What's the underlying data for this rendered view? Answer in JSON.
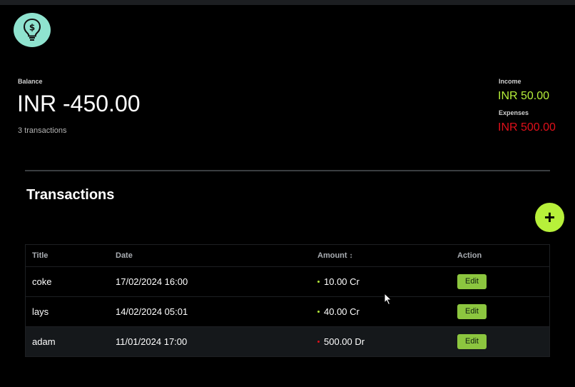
{
  "app": {
    "logo_icon": "lightbulb-dollar-icon"
  },
  "summary": {
    "balance_label": "Balance",
    "balance_value": "INR -450.00",
    "transaction_count": "3 transactions",
    "income_label": "Income",
    "income_value": "INR 50.00",
    "expenses_label": "Expenses",
    "expenses_value": "INR 500.00"
  },
  "transactions": {
    "title": "Transactions",
    "add_icon": "plus-icon",
    "add_label": "+",
    "columns": {
      "title": "Title",
      "date": "Date",
      "amount": "Amount",
      "action": "Action"
    },
    "rows": [
      {
        "title": "coke",
        "date": "17/02/2024 16:00",
        "amount": "10.00 Cr",
        "type": "credit",
        "action": "Edit"
      },
      {
        "title": "lays",
        "date": "14/02/2024 05:01",
        "amount": "40.00 Cr",
        "type": "credit",
        "action": "Edit"
      },
      {
        "title": "adam",
        "date": "11/01/2024 17:00",
        "amount": "500.00 Dr",
        "type": "debit",
        "action": "Edit"
      }
    ]
  },
  "colors": {
    "background": "#000000",
    "accent": "#b7f03a",
    "income": "#b7f03a",
    "expense": "#e0101a",
    "edit_button": "#8cc63f",
    "logo_bg": "#8fe3cf"
  }
}
